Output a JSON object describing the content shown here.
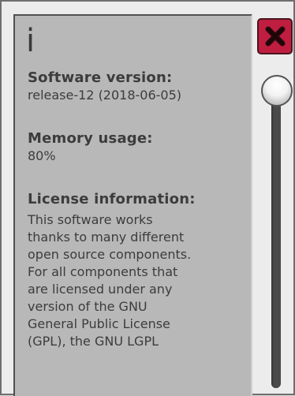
{
  "info_glyph": "i",
  "software_version": {
    "heading": "Software version:",
    "value": "release-12 (2018-06-05)"
  },
  "memory_usage": {
    "heading": "Memory usage:",
    "value": "80%"
  },
  "license": {
    "heading": "License information:",
    "lines": [
      "This software works",
      "thanks to many different",
      "open source components.",
      "For all components that",
      "are licensed under any",
      "version of the GNU",
      "General Public License",
      "(GPL), the GNU LGPL"
    ]
  },
  "close_button": {
    "icon": "close-icon",
    "color": "#bf1e40"
  },
  "scrollbar": {
    "position_fraction": 0.0
  }
}
